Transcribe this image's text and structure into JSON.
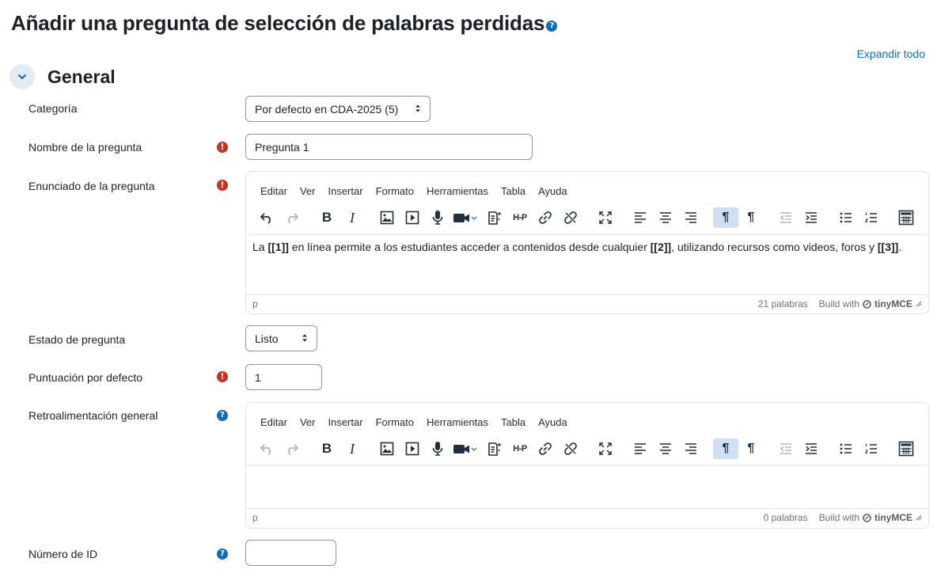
{
  "page": {
    "title": "Añadir una pregunta de selección de palabras perdidas",
    "expand_all": "Expandir todo"
  },
  "section": {
    "title": "General"
  },
  "fields": {
    "category": {
      "label": "Categoría",
      "value": "Por defecto en CDA-2025 (5)"
    },
    "name": {
      "label": "Nombre de la pregunta",
      "value": "Pregunta 1"
    },
    "text": {
      "label": "Enunciado de la pregunta"
    },
    "status": {
      "label": "Estado de pregunta",
      "value": "Listo"
    },
    "default_mark": {
      "label": "Puntuación por defecto",
      "value": "1"
    },
    "general_feedback": {
      "label": "Retroalimentación general"
    },
    "id_number": {
      "label": "Número de ID",
      "value": ""
    }
  },
  "editor_menu": [
    "Editar",
    "Ver",
    "Insertar",
    "Formato",
    "Herramientas",
    "Tabla",
    "Ayuda"
  ],
  "editor1": {
    "content": {
      "p1": "La ",
      "g1": "[[1]]",
      "p2": " en línea permite a los estudiantes acceder a contenidos desde cualquier ",
      "g2": "[[2]]",
      "p3": ", utilizando recursos como videos, foros y ",
      "g3": "[[3]]",
      "p4": "."
    },
    "path": "p",
    "word_count": "21 palabras",
    "build_with": "Build with",
    "brand": "tinyMCE"
  },
  "editor2": {
    "path": "p",
    "word_count": "0 palabras",
    "build_with": "Build with",
    "brand": "tinyMCE"
  },
  "toolbar_labels": {
    "h5p": "H-P",
    "ltr": "¶",
    "rtl": "¶"
  },
  "icons": {
    "required": "!",
    "help": "?"
  },
  "colors": {
    "accent": "#0f6cbf",
    "required": "#ca3120",
    "active_button": "#cfe0f5"
  }
}
